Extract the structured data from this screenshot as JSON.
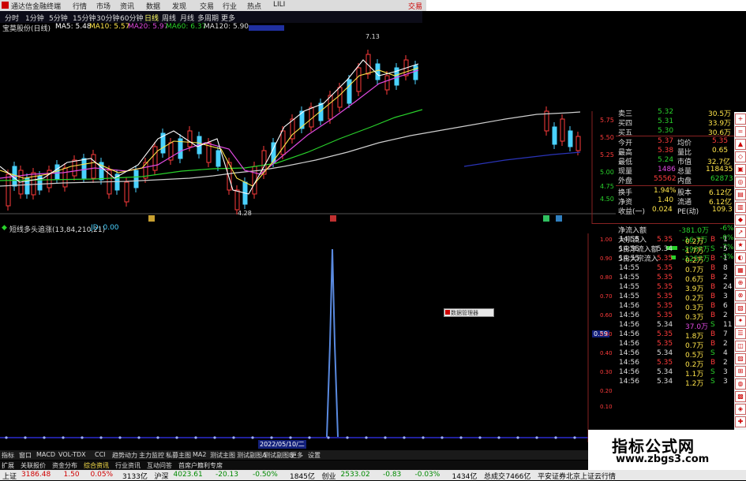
{
  "titlebar": {
    "app_title": "通达信金融终端",
    "menu": [
      "行情",
      "市场",
      "资讯",
      "数据",
      "发现",
      "交易",
      "行业",
      "热点",
      "LILI"
    ],
    "trade_label": "交易"
  },
  "toolbar": {
    "items": [
      "分时",
      "1分钟",
      "5分钟",
      "15分钟",
      "30分钟",
      "60分钟",
      "日线",
      "周线",
      "月线",
      "多周期",
      "更多"
    ],
    "selected": "日线"
  },
  "ma_legend": {
    "stock": "宝莫股份(日线)",
    "items": [
      {
        "label": "MA5: 5.48",
        "color": "#ffffff"
      },
      {
        "label": "MA10: 5.57",
        "color": "#ffe54a"
      },
      {
        "label": "MA20: 5.97",
        "color": "#e04ae0"
      },
      {
        "label": "MA60: 6.37",
        "color": "#29d12b"
      },
      {
        "label": "MA120: 5.90",
        "color": "#dddddd"
      }
    ]
  },
  "price_chart": {
    "high_label": "7.13",
    "low_label": "4.28",
    "y_ticks": [
      "5.75",
      "5.50",
      "5.25",
      "5.00",
      "4.75",
      "4.50"
    ]
  },
  "orderbook": [
    {
      "label": "卖三",
      "price": "5.32",
      "vol": "30.5万"
    },
    {
      "label": "买四",
      "price": "5.31",
      "vol": "33.9万"
    },
    {
      "label": "买五",
      "price": "5.30",
      "vol": "30.6万"
    }
  ],
  "quotes": [
    {
      "l1": "今开",
      "v1": "5.37",
      "l2": "均价",
      "v2": "5.35"
    },
    {
      "l1": "最高",
      "v1": "5.38",
      "l2": "量比",
      "v2": "0.65"
    },
    {
      "l1": "最低",
      "v1": "5.24",
      "l2": "市值",
      "v2": "32.7亿"
    },
    {
      "l1": "现量",
      "v1": "1486",
      "l2": "总量",
      "v2": "118435"
    },
    {
      "l1": "外盘",
      "v1": "55562",
      "l2": "内盘",
      "v2": "62873"
    },
    {
      "l1": "换手",
      "v1": "1.94%",
      "l2": "股本",
      "v2": "6.12亿"
    },
    {
      "l1": "净资",
      "v1": "1.40",
      "l2": "流通",
      "v2": "6.12亿"
    },
    {
      "l1": "收益(一)",
      "v1": "0.024",
      "l2": "PE(动)",
      "v2": "109.3"
    }
  ],
  "flow": [
    {
      "label": "净流入额",
      "value": "-381.0万",
      "pct": "-6%"
    },
    {
      "label": "大宗流入",
      "value": "-16.7万",
      "pct": "-0%"
    },
    {
      "label": "5日净流入额",
      "value": "-2987万",
      "pct": "-7%"
    },
    {
      "label": "5日大宗流入",
      "value": "-1257万",
      "pct": "-3%"
    }
  ],
  "indicator": {
    "legend": "短线多头追涨(13,84,210,21)",
    "jd": "JD: 0.00",
    "y_ticks": [
      "1.00",
      "0.90",
      "0.80",
      "0.70",
      "0.60",
      "0.50",
      "0.40",
      "0.30",
      "0.20",
      "0.10"
    ],
    "value_badge": "0.59",
    "date_label": "2022/05/10/二"
  },
  "ticks": [
    {
      "t": "14:55",
      "p": "5.35",
      "v": "0.2万",
      "d": "B",
      "n": "1"
    },
    {
      "t": "14:55",
      "p": "5.34",
      "v": "1.7万",
      "d": "S",
      "n": "5"
    },
    {
      "t": "14:55",
      "p": "5.35",
      "v": "0.2万",
      "d": "B",
      "n": "1"
    },
    {
      "t": "14:55",
      "p": "5.35",
      "v": "0.7万",
      "d": "B",
      "n": "8"
    },
    {
      "t": "14:55",
      "p": "5.35",
      "v": "0.6万",
      "d": "B",
      "n": "2"
    },
    {
      "t": "14:55",
      "p": "5.35",
      "v": "3.9万",
      "d": "B",
      "n": "24"
    },
    {
      "t": "14:55",
      "p": "5.35",
      "v": "0.2万",
      "d": "B",
      "n": "3"
    },
    {
      "t": "14:56",
      "p": "5.35",
      "v": "0.3万",
      "d": "B",
      "n": "6"
    },
    {
      "t": "14:56",
      "p": "5.35",
      "v": "0.3万",
      "d": "B",
      "n": "2"
    },
    {
      "t": "14:56",
      "p": "5.34",
      "v": "37.0万",
      "d": "S",
      "n": "11"
    },
    {
      "t": "14:56",
      "p": "5.35",
      "v": "1.8万",
      "d": "B",
      "n": "7"
    },
    {
      "t": "14:56",
      "p": "5.35",
      "v": "0.7万",
      "d": "B",
      "n": "2"
    },
    {
      "t": "14:56",
      "p": "5.34",
      "v": "0.5万",
      "d": "S",
      "n": "4"
    },
    {
      "t": "14:56",
      "p": "5.35",
      "v": "0.2万",
      "d": "B",
      "n": "2"
    },
    {
      "t": "14:56",
      "p": "5.34",
      "v": "1.1万",
      "d": "S",
      "n": "3"
    },
    {
      "t": "14:56",
      "p": "5.34",
      "v": "1.2万",
      "d": "S",
      "n": "3"
    }
  ],
  "bottom_tabs": [
    "指标",
    "窗口",
    "MACD",
    "VOL-TDX",
    "CCI",
    "趋势动力",
    "主力监控",
    "私募主图",
    "MA2",
    "测试主图",
    "测试副图A",
    "测试副图B",
    "更多",
    "设置"
  ],
  "bottom_tabs2": [
    "扩展",
    "关联报价",
    "资金分布",
    "综合资讯",
    "行业资讯",
    "互动问答",
    "首席户籍利专席"
  ],
  "statusbar": [
    {
      "text": "上证",
      "cls": "k"
    },
    {
      "text": "3186.48",
      "cls": "r"
    },
    {
      "text": "1.50",
      "cls": "r"
    },
    {
      "text": "0.05%",
      "cls": "r"
    },
    {
      "text": "3133亿",
      "cls": "k"
    },
    {
      "text": "沪深",
      "cls": "k"
    },
    {
      "text": "4023.61",
      "cls": "g"
    },
    {
      "text": "-20.13",
      "cls": "g"
    },
    {
      "text": "-0.50%",
      "cls": "g"
    },
    {
      "text": "1845亿",
      "cls": "k"
    },
    {
      "text": "创业",
      "cls": "k"
    },
    {
      "text": "2533.02",
      "cls": "g"
    },
    {
      "text": "-0.83",
      "cls": "g"
    },
    {
      "text": "-0.03%",
      "cls": "g"
    },
    {
      "text": "1434亿",
      "cls": "k"
    },
    {
      "text": "总成交",
      "cls": "k"
    },
    {
      "text": "7466亿",
      "cls": "k"
    },
    {
      "text": "平安证券北京上证云行情",
      "cls": "k"
    }
  ],
  "brand": {
    "line1": "指标公式网",
    "line2": "www.zbgs3.com"
  },
  "popup": "数据管理器"
}
